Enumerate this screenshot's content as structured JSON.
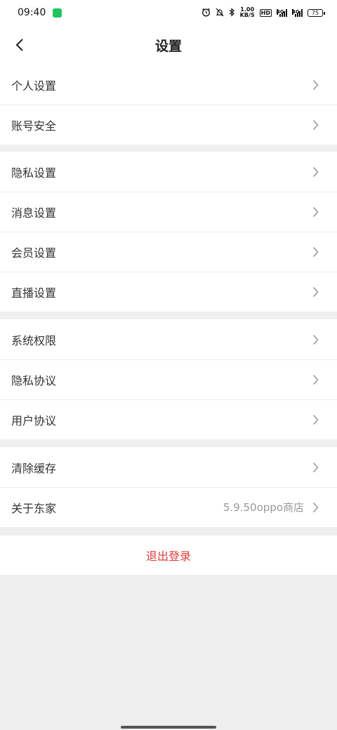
{
  "status_bar": {
    "time": "09:40",
    "speed_value": "1.00",
    "speed_unit": "KB/S",
    "hd_label": "HD",
    "sim1_net": "4G",
    "sim2_net": "4G",
    "battery": "75",
    "icons": [
      "alarm-icon",
      "mute-icon",
      "bluetooth-icon"
    ]
  },
  "nav": {
    "title": "设置",
    "back_icon": "chevron-left-icon"
  },
  "groups": [
    {
      "items": [
        {
          "label": "个人设置"
        },
        {
          "label": "账号安全"
        }
      ]
    },
    {
      "items": [
        {
          "label": "隐私设置"
        },
        {
          "label": "消息设置"
        },
        {
          "label": "会员设置"
        },
        {
          "label": "直播设置"
        }
      ]
    },
    {
      "items": [
        {
          "label": "系统权限"
        },
        {
          "label": "隐私协议"
        },
        {
          "label": "用户协议"
        }
      ]
    },
    {
      "items": [
        {
          "label": "清除缓存"
        },
        {
          "label": "关于东家",
          "value": "5.9.50oppo商店"
        }
      ]
    }
  ],
  "logout_label": "退出登录",
  "colors": {
    "logout_text": "#e23b3b",
    "page_background": "#efefef",
    "chevron": "#999999"
  }
}
